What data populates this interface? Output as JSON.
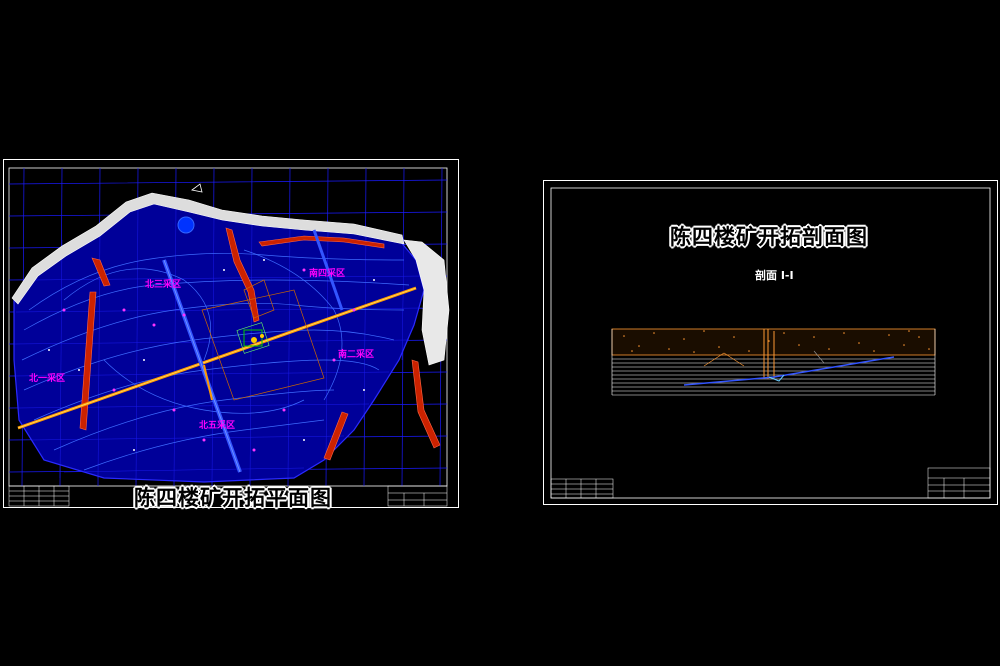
{
  "plan_sheet": {
    "title": "陈四楼矿开拓平面图",
    "zones": [
      {
        "id": "north-3",
        "label": "北三采区"
      },
      {
        "id": "south-4",
        "label": "南四采区"
      },
      {
        "id": "north-1",
        "label": "北一采区"
      },
      {
        "id": "south-2",
        "label": "南二采区"
      },
      {
        "id": "north-5",
        "label": "北五采区"
      }
    ]
  },
  "section_sheet": {
    "title": "陈四楼矿开拓剖面图",
    "subtitle": "剖面 I-I"
  },
  "colors": {
    "background": "#000000",
    "frame": "#ffffff",
    "grid": "#0000ff",
    "contour": "#3366ff",
    "zone_label": "#ff00ff",
    "roadway": "#ff9900",
    "fault": "#cc2200",
    "shaft": "#00cc00",
    "stratum": "#ff9933"
  }
}
